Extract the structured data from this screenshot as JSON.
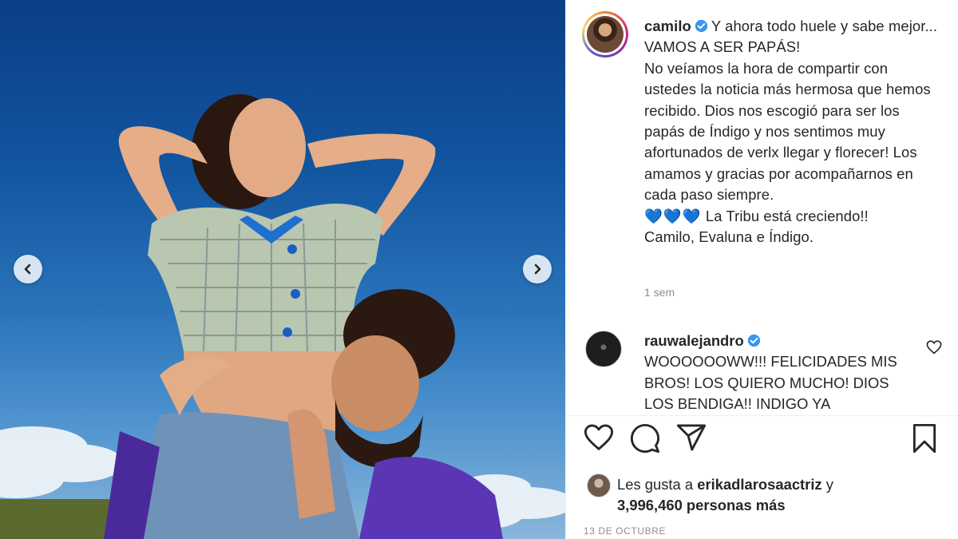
{
  "post": {
    "author": "camilo",
    "caption_first": "Y ahora todo huele y sabe mejor...",
    "caption_lines": [
      "VAMOS A SER PAPÁS!",
      "No veíamos la hora de compartir con ustedes la noticia más hermosa que hemos recibido. Dios nos escogió para ser los papás de Índigo y nos sentimos muy afortunados de verlx llegar y florecer! Los amamos y gracias por acompañarnos en cada paso siempre."
    ],
    "hearts": "💙💙💙",
    "tribe_line": "La Tribu está creciendo!!",
    "signature": "Camilo, Evaluna e Índigo.",
    "time_ago": "1 sem"
  },
  "comment": {
    "user": "rauwalejandro",
    "text": "WOOOOOOWW!!! FELICIDADES MIS BROS! LOS QUIERO MUCHO! DIOS LOS BENDIGA!! INDIGO YA"
  },
  "likes": {
    "prefix": "Les gusta a",
    "liker": "erikadlarosaactriz",
    "suffix": "y",
    "count": "3,996,460 personas más"
  },
  "date": "13 DE OCTUBRE",
  "colors": {
    "verified": "#3897f0",
    "text": "#262626",
    "muted": "#8e8e8e",
    "sky": "#11549f"
  },
  "icons": {
    "like": "heart-outline-icon",
    "comment": "speech-bubble-icon",
    "share": "paper-plane-icon",
    "save": "bookmark-icon",
    "prev": "chevron-left-icon",
    "next": "chevron-right-icon"
  }
}
